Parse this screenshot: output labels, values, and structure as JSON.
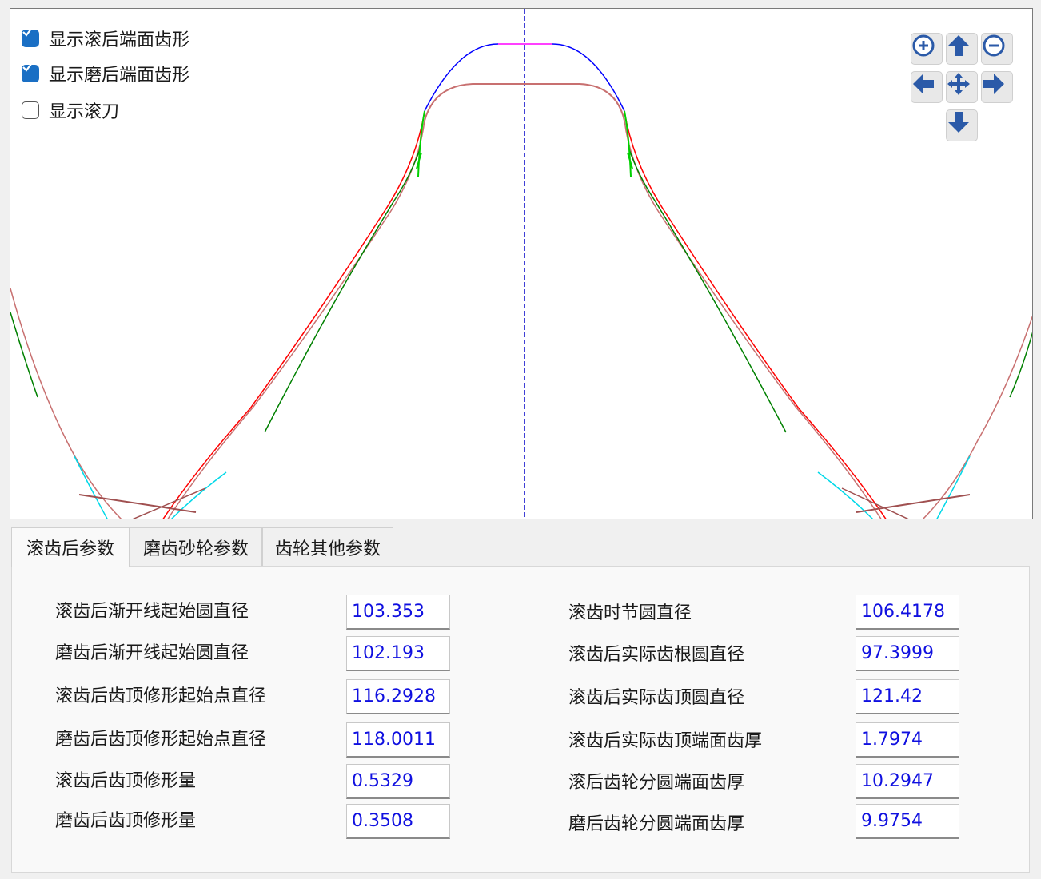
{
  "checkboxes": [
    {
      "label": "显示滚后端面齿形",
      "checked": true
    },
    {
      "label": "显示磨后端面齿形",
      "checked": true
    },
    {
      "label": "显示滚刀",
      "checked": false
    }
  ],
  "nav_icons": [
    "zoom-in-icon",
    "arrow-up-icon",
    "zoom-out-icon",
    "arrow-left-icon",
    "pan-center-icon",
    "arrow-right-icon",
    "arrow-down-icon"
  ],
  "colors": {
    "hob_profile": "#ff0000",
    "hob_tip": "#0000ff",
    "tip_flat": "#ff00ff",
    "grind_profile": "#c87070",
    "green_curve": "#008000",
    "bright_green": "#00d000",
    "cyan_curve": "#00d8e8",
    "brown_line": "#a05050",
    "center_line": "#0000c8",
    "nav_blue": "#2b5aa8",
    "value_text": "#1010e0"
  },
  "tabs": [
    "滚齿后参数",
    "磨齿砂轮参数",
    "齿轮其他参数"
  ],
  "active_tab": 0,
  "params_left": [
    {
      "label": "滚齿后渐开线起始圆直径",
      "value": "103.353"
    },
    {
      "label": "磨齿后渐开线起始圆直径",
      "value": "102.193"
    },
    {
      "label": "滚齿后齿顶修形起始点直径",
      "value": "116.2928"
    },
    {
      "label": "磨齿后齿顶修形起始点直径",
      "value": "118.0011"
    },
    {
      "label": "滚齿后齿顶修形量",
      "value": "0.5329"
    },
    {
      "label": "磨齿后齿顶修形量",
      "value": "0.3508"
    }
  ],
  "params_right": [
    {
      "label": "滚齿时节圆直径",
      "value": "106.4178"
    },
    {
      "label": "滚齿后实际齿根圆直径",
      "value": "97.3999"
    },
    {
      "label": "滚齿后实际齿顶圆直径",
      "value": "121.42"
    },
    {
      "label": "滚齿后实际齿顶端面齿厚",
      "value": "1.7974"
    },
    {
      "label": "滚后齿轮分圆端面齿厚",
      "value": "10.2947"
    },
    {
      "label": "磨后齿轮分圆端面齿厚",
      "value": "9.9754"
    }
  ]
}
